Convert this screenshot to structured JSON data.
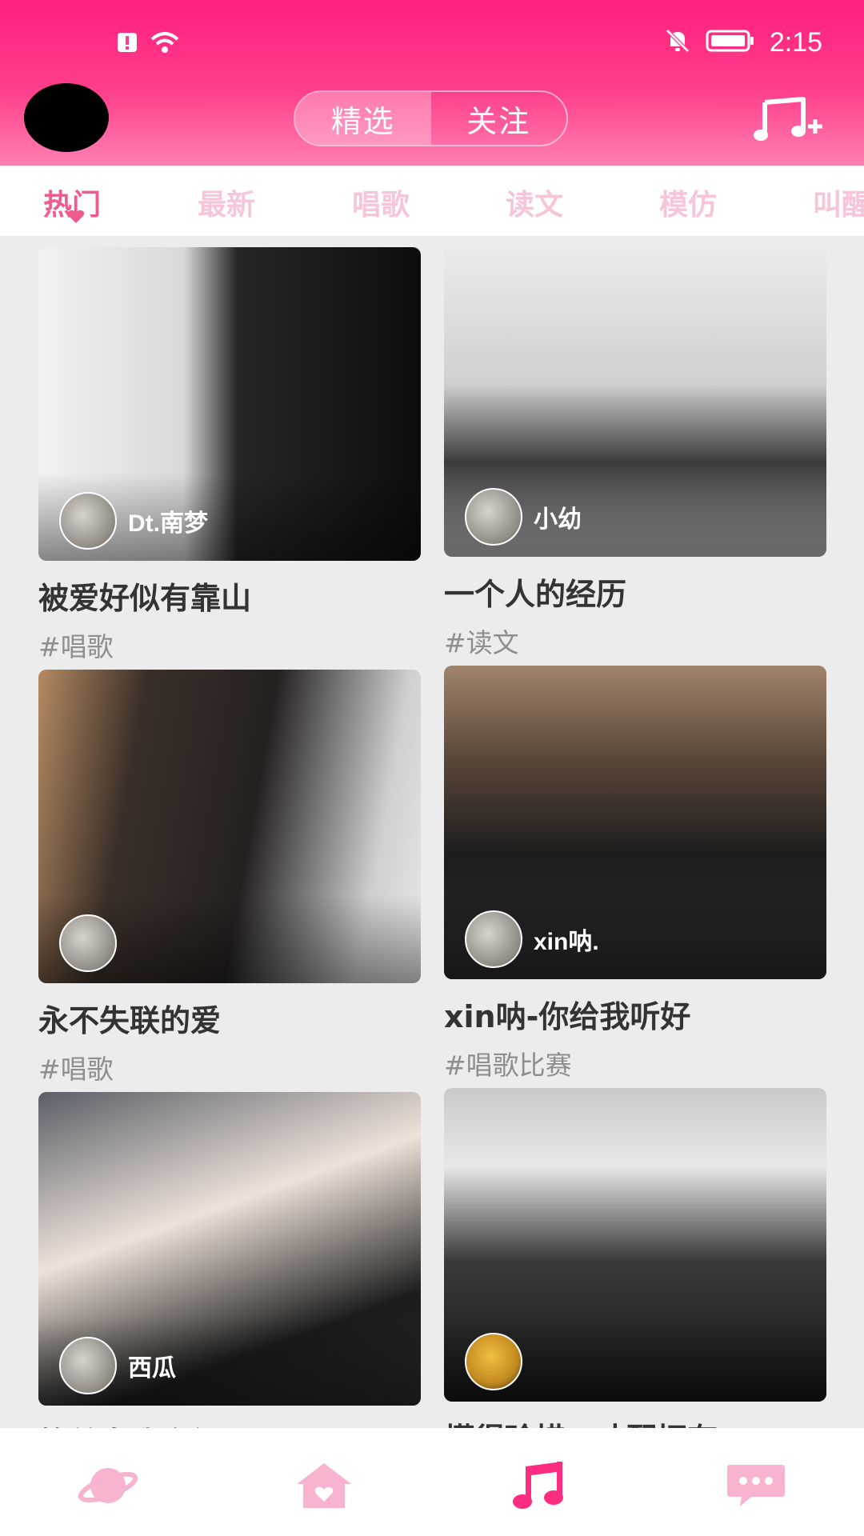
{
  "status_bar": {
    "time": "2:15"
  },
  "header": {
    "tabs": [
      {
        "label": "精选",
        "active": true
      },
      {
        "label": "关注",
        "active": false
      }
    ]
  },
  "categories": [
    {
      "label": "热门",
      "active": true
    },
    {
      "label": "最新",
      "active": false
    },
    {
      "label": "唱歌",
      "active": false
    },
    {
      "label": "读文",
      "active": false
    },
    {
      "label": "模仿",
      "active": false
    },
    {
      "label": "叫醒",
      "active": false
    }
  ],
  "feed": [
    {
      "title": "被爱好似有靠山",
      "tag": "#唱歌",
      "author": "Dt.南梦"
    },
    {
      "title": "一个人的经历",
      "tag": "#读文",
      "author": "小幼"
    },
    {
      "title": "永不失联的爱",
      "tag": "#唱歌",
      "author": ""
    },
    {
      "title": "xin呐-你给我听好",
      "tag": "#唱歌比赛",
      "author": "xin呐."
    },
    {
      "title": "简单自我介绍",
      "tag": "",
      "author": "西瓜"
    },
    {
      "title": "懂得珍惜，才配拥有",
      "tag": "",
      "author": ""
    }
  ],
  "colors": {
    "accent": "#ff2d80",
    "active_tab": "#f05b8e",
    "inactive_tab": "#f6c6d8"
  },
  "icons": {
    "bottom_nav": [
      "planet-icon",
      "home-heart-icon",
      "music-note-icon",
      "chat-bubble-icon"
    ]
  }
}
